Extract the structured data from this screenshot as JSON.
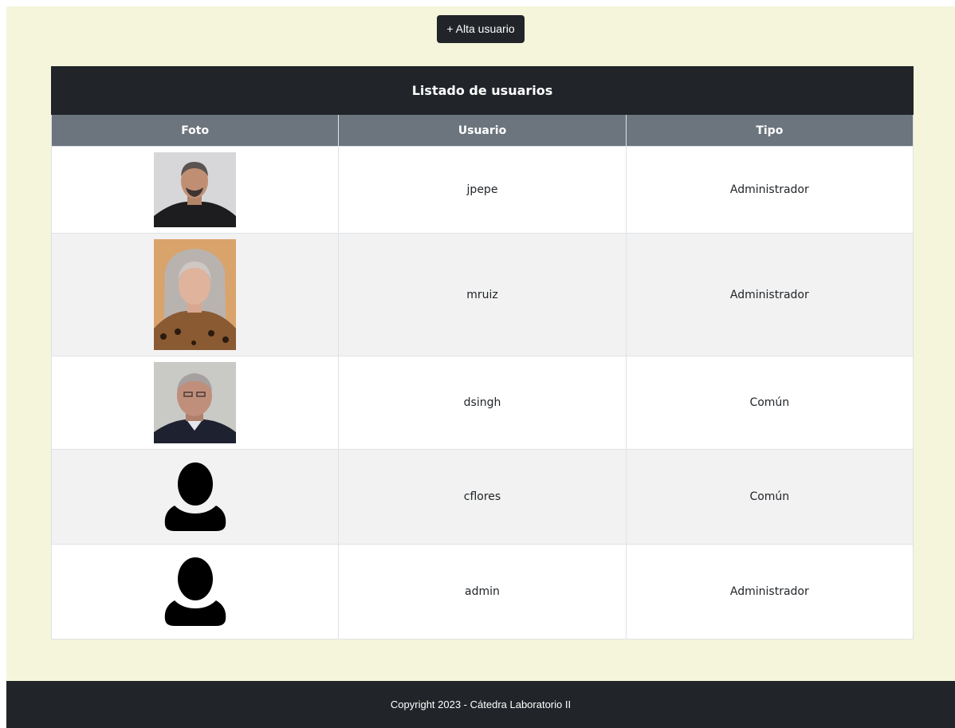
{
  "toolbar": {
    "add_user_label": "+ Alta usuario"
  },
  "table": {
    "caption": "Listado de usuarios",
    "columns": [
      "Foto",
      "Usuario",
      "Tipo"
    ],
    "rows": [
      {
        "photo": "photo-man-gray-hair",
        "usuario": "jpepe",
        "tipo": "Administrador"
      },
      {
        "photo": "photo-woman-gray-hair",
        "usuario": "mruiz",
        "tipo": "Administrador"
      },
      {
        "photo": "photo-man-bald",
        "usuario": "dsingh",
        "tipo": "Común"
      },
      {
        "photo": "user-placeholder-icon",
        "usuario": "cflores",
        "tipo": "Común"
      },
      {
        "photo": "user-placeholder-icon",
        "usuario": "admin",
        "tipo": "Administrador"
      }
    ]
  },
  "footer": {
    "text": "Copyright 2023 - Cátedra Laboratorio II"
  },
  "colors": {
    "page_background": "#f5f5dc",
    "dark": "#212529",
    "table_header": "#6c757d",
    "row_alt": "#f2f2f2"
  }
}
